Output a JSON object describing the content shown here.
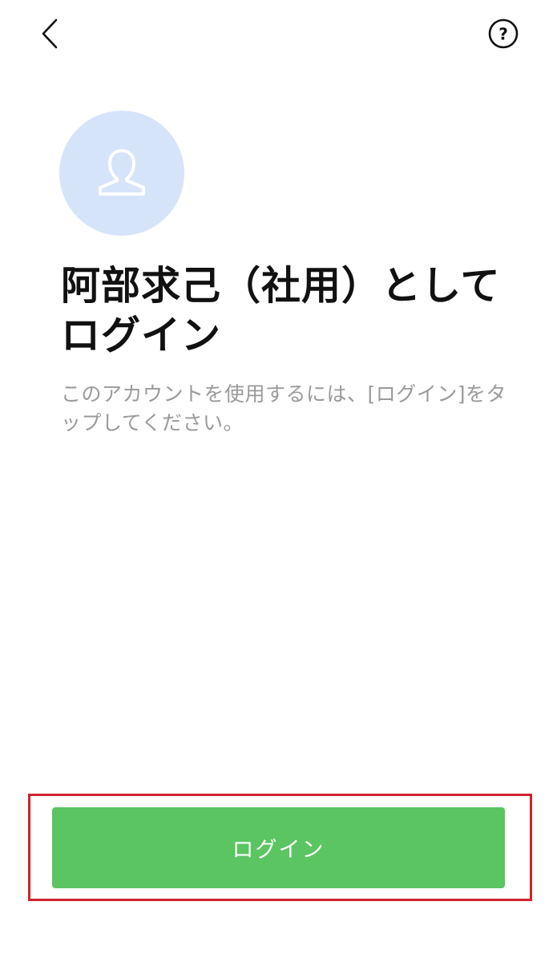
{
  "header": {
    "back_icon": "chevron-left-icon",
    "help_icon": "question-circle-icon",
    "help_symbol": "?"
  },
  "avatar": {
    "icon": "person-silhouette-icon",
    "bg_color": "#d6e4fa"
  },
  "main": {
    "title": "阿部求己（社用）としてログイン",
    "instruction": "このアカウントを使用するには、[ログイン]をタップしてください。"
  },
  "footer": {
    "login_label": "ログイン",
    "button_color": "#5bc561",
    "highlight_color": "#d0232e"
  }
}
